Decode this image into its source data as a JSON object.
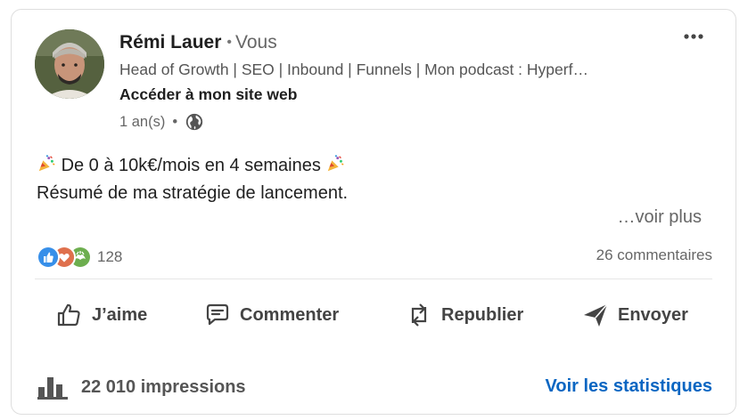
{
  "author": {
    "name": "Rémi Lauer",
    "separator": "•",
    "degree": "Vous",
    "headline": "Head of Growth | SEO | Inbound | Funnels | Mon podcast : Hyperf…",
    "site_link": "Accéder à mon site web",
    "time": "1 an(s)",
    "meta_dot": "•"
  },
  "post": {
    "line1": "De 0 à 10k€/mois en 4 semaines",
    "line2": "Résumé de ma stratégie de lancement.",
    "see_more": "…voir plus"
  },
  "social": {
    "reaction_count": "128",
    "comments": "26 commentaires"
  },
  "actions": {
    "like": "J’aime",
    "comment": "Commenter",
    "repost": "Republier",
    "send": "Envoyer"
  },
  "footer": {
    "impressions": "22 010 impressions",
    "stats_link": "Voir les statistiques"
  },
  "colors": {
    "link_blue": "#0a66c2",
    "like_blue": "#378fe9",
    "love_red": "#df704d",
    "support_green": "#6dae4f"
  },
  "icons": [
    "more-icon",
    "globe-icon",
    "party-popper-icon",
    "like-reaction-icon",
    "love-reaction-icon",
    "support-reaction-icon",
    "thumb-up-icon",
    "comment-icon",
    "repost-icon",
    "send-icon",
    "bar-chart-icon"
  ]
}
